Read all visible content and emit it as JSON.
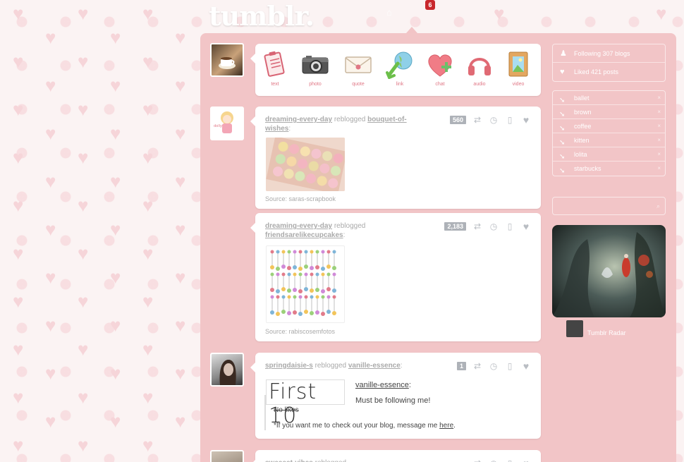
{
  "header": {
    "logo": "tumblr.",
    "notification_count": "6"
  },
  "post_types": [
    {
      "label": "text",
      "icon": "clipboard-icon"
    },
    {
      "label": "photo",
      "icon": "camera-icon"
    },
    {
      "label": "quote",
      "icon": "envelope-icon"
    },
    {
      "label": "link",
      "icon": "globe-arrow-icon"
    },
    {
      "label": "chat",
      "icon": "heart-plus-icon"
    },
    {
      "label": "audio",
      "icon": "headphones-icon"
    },
    {
      "label": "video",
      "icon": "film-icon"
    }
  ],
  "posts": [
    {
      "author": "dreaming-every-day",
      "action": "reblogged",
      "source_blog": "bouquet-of-wishes",
      "notes": "560",
      "source_label": "Source: saras-scrapbook"
    },
    {
      "author": "dreaming-every-day",
      "action": "reblogged",
      "source_blog": "friendsarelikecupcakes",
      "notes": "2,183",
      "source_label": "Source: rabiscosemfotos"
    },
    {
      "author": "springdaisie-s",
      "action": "reblogged",
      "source_blog": "vanille-essence",
      "notes": "1",
      "image_text": "First 10",
      "quote_author": "vanille-essence",
      "quote_text": "Must be following me!",
      "strike_text": "No likes",
      "footer_text": "*If you want me to check out your blog, message me ",
      "footer_link": "here",
      "footer_end": "."
    },
    {
      "author": "sweeeet-vibes",
      "action": "reblogged"
    }
  ],
  "sidebar": {
    "stats": [
      {
        "label": "Following 307 blogs",
        "icon": "person-icon"
      },
      {
        "label": "Liked 421 posts",
        "icon": "heart-icon"
      }
    ],
    "tags": [
      {
        "label": "ballet"
      },
      {
        "label": "brown"
      },
      {
        "label": "coffee"
      },
      {
        "label": "kitten"
      },
      {
        "label": "lolita"
      },
      {
        "label": "starbucks"
      }
    ],
    "radar_label": "Tumblr Radar"
  },
  "colors": {
    "dashboard_bg": "#f2c5c7",
    "accent_pink": "#e07886",
    "badge_red": "#c8272c"
  }
}
